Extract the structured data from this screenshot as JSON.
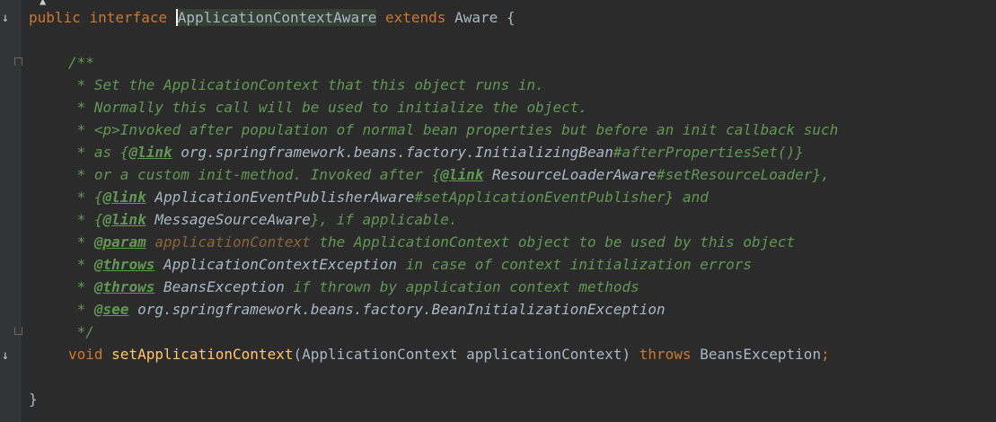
{
  "gutter": {
    "line_marks": [
      "↓",
      "↓"
    ]
  },
  "code": {
    "l1": {
      "public": "public",
      "interface": "interface",
      "name": "ApplicationContextAware",
      "extends": "extends",
      "super": "Aware",
      "brace": " {"
    },
    "l2": {
      "open": "/**"
    },
    "l3": {
      "text": " * Set the ApplicationContext that this object runs in."
    },
    "l4": {
      "text": " * Normally this call will be used to initialize the object."
    },
    "l5": {
      "text": " * <p>Invoked after population of normal bean properties but before an init callback such"
    },
    "l6": {
      "pre": " * as {",
      "tag": "@link",
      "ref": " org.springframework.beans.factory.InitializingBean",
      "post": "#afterPropertiesSet()}"
    },
    "l7": {
      "pre": " * or a custom init-method. Invoked after {",
      "tag": "@link",
      "ref": " ResourceLoaderAware",
      "post": "#setResourceLoader},"
    },
    "l8": {
      "pre": " * {",
      "tag": "@link",
      "ref": " ApplicationEventPublisherAware",
      "post": "#setApplicationEventPublisher} and"
    },
    "l9": {
      "pre": " * {",
      "tag": "@link",
      "ref": " MessageSourceAware",
      "post": "}, if applicable."
    },
    "l10": {
      "pre": " * ",
      "tag": "@param",
      "param": " applicationContext",
      "post": " the ApplicationContext object to be used by this object"
    },
    "l11": {
      "pre": " * ",
      "tag": "@throws",
      "ref": " ApplicationContextException",
      "post": " in case of context initialization errors"
    },
    "l12": {
      "pre": " * ",
      "tag": "@throws",
      "ref": " BeansException",
      "post": " if thrown by application context methods"
    },
    "l13": {
      "pre": " * ",
      "tag": "@see",
      "ref": " org.springframework.beans.factory.BeanInitializationException"
    },
    "l14": {
      "close": " */"
    },
    "l15": {
      "void": "void",
      "method": "setApplicationContext",
      "params": "(ApplicationContext applicationContext) ",
      "throws": "throws",
      "exc": " BeansException",
      "semi": ";"
    },
    "l16": {
      "close": "}"
    }
  }
}
